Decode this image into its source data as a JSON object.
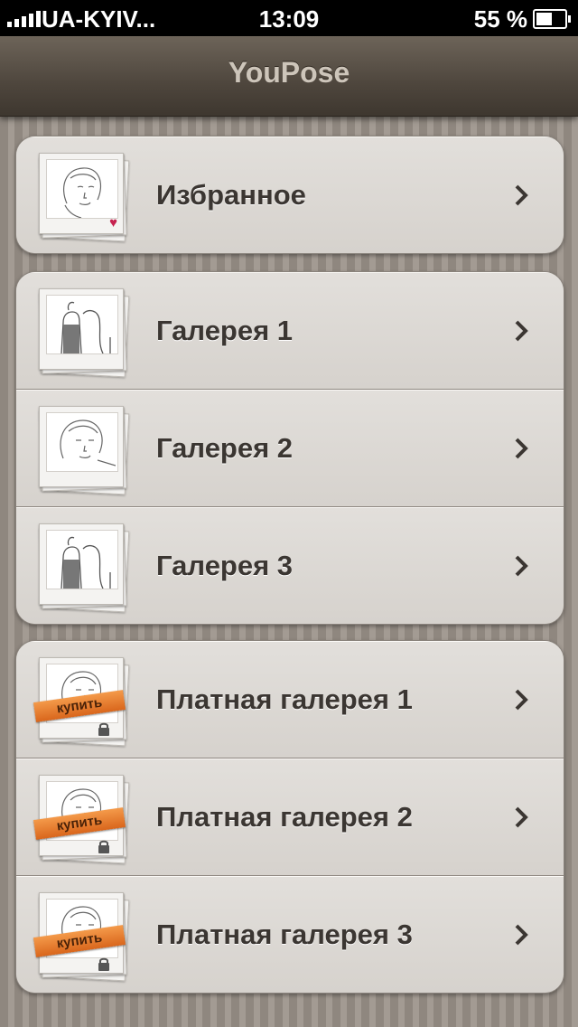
{
  "status_bar": {
    "carrier": "UA-KYIV...",
    "time": "13:09",
    "battery": "55 %",
    "battery_level": 0.55
  },
  "nav": {
    "title": "YouPose"
  },
  "groups": [
    {
      "rows": [
        {
          "label": "Избранное",
          "thumb": "favorite"
        }
      ]
    },
    {
      "rows": [
        {
          "label": "Галерея 1",
          "thumb": "couple"
        },
        {
          "label": "Галерея 2",
          "thumb": "portrait"
        },
        {
          "label": "Галерея 3",
          "thumb": "couple"
        }
      ]
    },
    {
      "rows": [
        {
          "label": "Платная галерея 1",
          "thumb": "paid",
          "badge": "купить"
        },
        {
          "label": "Платная галерея 2",
          "thumb": "paid",
          "badge": "купить"
        },
        {
          "label": "Платная галерея 3",
          "thumb": "paid",
          "badge": "купить"
        }
      ]
    }
  ]
}
